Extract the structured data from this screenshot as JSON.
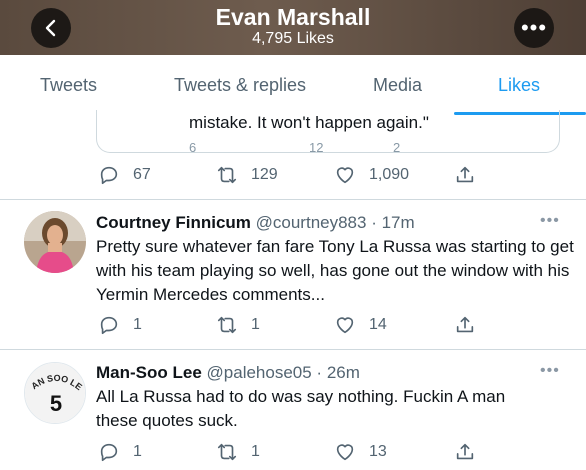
{
  "header": {
    "title": "Evan Marshall",
    "subtitle": "4,795 Likes",
    "back_icon": "back-arrow-icon",
    "more_icon": "more-icon",
    "more_glyph": "•••"
  },
  "tabs": [
    {
      "label": "Tweets",
      "active": false
    },
    {
      "label": "Tweets & replies",
      "active": false
    },
    {
      "label": "Media",
      "active": false
    },
    {
      "label": "Likes",
      "active": true
    }
  ],
  "accent_color": "#1d9bf0",
  "quoted": {
    "text": "mistake. It won't happen again.\"",
    "partial_counts": [
      "6",
      "12",
      "2"
    ]
  },
  "first_actions": {
    "replies": "67",
    "retweets": "129",
    "likes": "1,090"
  },
  "tweets": [
    {
      "name": "Courtney Finnicum",
      "handle": "@courtney883",
      "sep": " · ",
      "time": "17m",
      "menu": "•••",
      "text": "Pretty sure whatever fan fare Tony La Russa was starting to get with his team playing so well, has gone out the window with his Yermin Mercedes comments...",
      "replies": "1",
      "retweets": "1",
      "likes": "14"
    },
    {
      "name": "Man-Soo Lee",
      "handle": "@palehose05",
      "sep": " · ",
      "time": "26m",
      "menu": "•••",
      "avatar_text": "MAN SOO LEE",
      "avatar_number": "5",
      "text": "All La Russa had to do was say nothing. Fuckin A man these quotes suck.",
      "replies": "1",
      "retweets": "1",
      "likes": "13"
    }
  ]
}
